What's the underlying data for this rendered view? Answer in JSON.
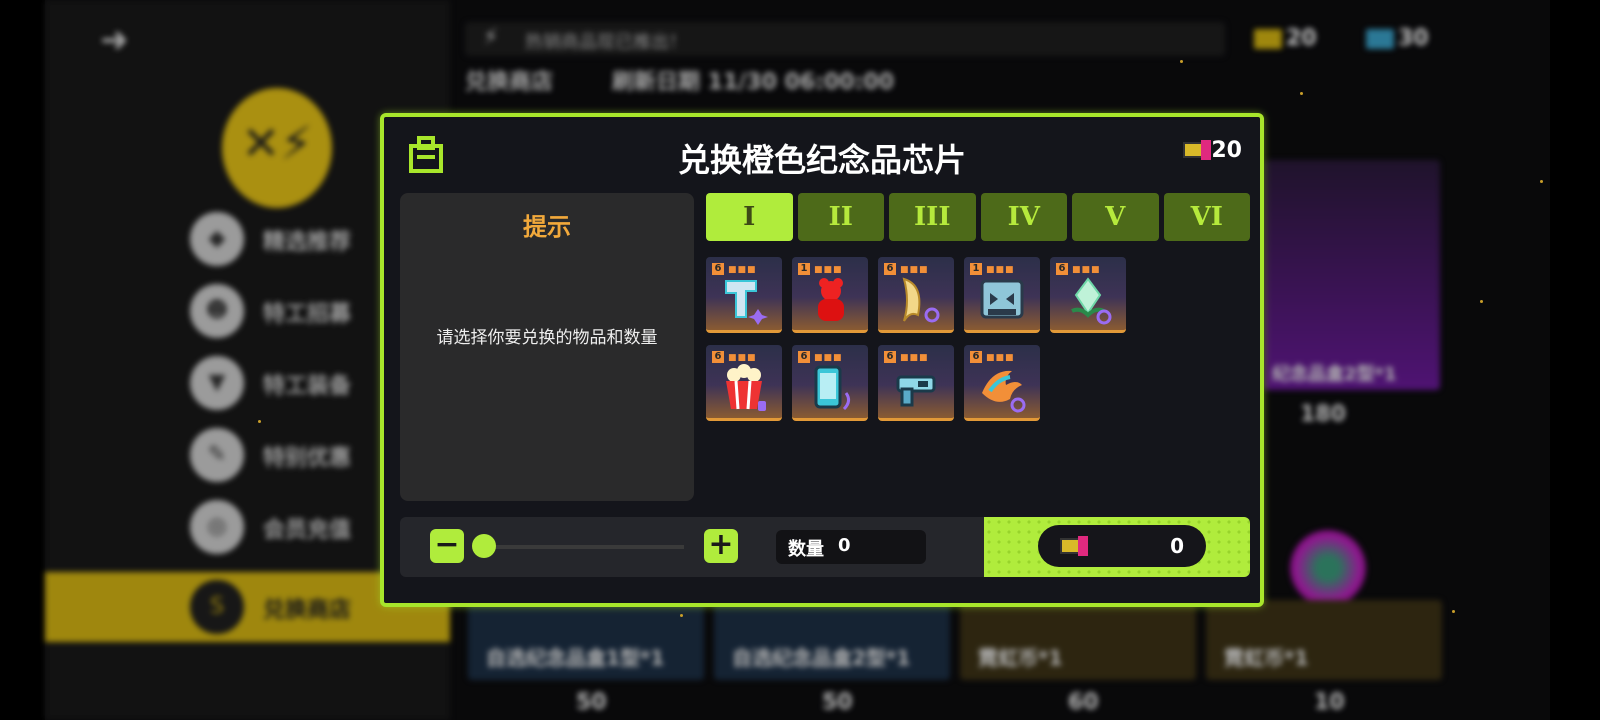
{
  "background": {
    "announcement": "热销商品现已推出！",
    "shop_title": "兑换商店",
    "refresh_date": "刷新日期 11/30 06:00:00",
    "currency_a": "20",
    "currency_b": "30",
    "nav": [
      "精选推荐",
      "特工招募",
      "特工装备",
      "特别优惠",
      "会员充值",
      "兑换商店"
    ],
    "cards": [
      {
        "name": "自选纪念品盒1型*1",
        "price": "50"
      },
      {
        "name": "自选纪念品盒2型*1",
        "price": "50"
      },
      {
        "name": "霓虹币*1",
        "price": "60"
      },
      {
        "name": "霓虹币*1",
        "price": "10"
      }
    ],
    "right_card": {
      "name": "纪念品盒2型*1",
      "price": "180"
    }
  },
  "modal": {
    "title": "兑换橙色纪念品芯片",
    "currency": "20",
    "hint_title": "提示",
    "hint_text": "请选择你要兑换的物品和数量",
    "tabs": [
      "I",
      "II",
      "III",
      "IV",
      "V",
      "VI"
    ],
    "active_tab": 0,
    "items": [
      {
        "icon": "scarf-icon",
        "qty": "6"
      },
      {
        "icon": "gummy-bear-icon",
        "qty": "1"
      },
      {
        "icon": "fang-icon",
        "qty": "6"
      },
      {
        "icon": "robot-helmet-icon",
        "qty": "1"
      },
      {
        "icon": "crystal-flower-icon",
        "qty": "6"
      },
      {
        "icon": "popcorn-icon",
        "qty": "6"
      },
      {
        "icon": "phone-icon",
        "qty": "6"
      },
      {
        "icon": "blaster-icon",
        "qty": "6"
      },
      {
        "icon": "phoenix-icon",
        "qty": "6"
      }
    ],
    "quantity_label": "数量",
    "quantity_value": "0",
    "cost_value": "0"
  }
}
